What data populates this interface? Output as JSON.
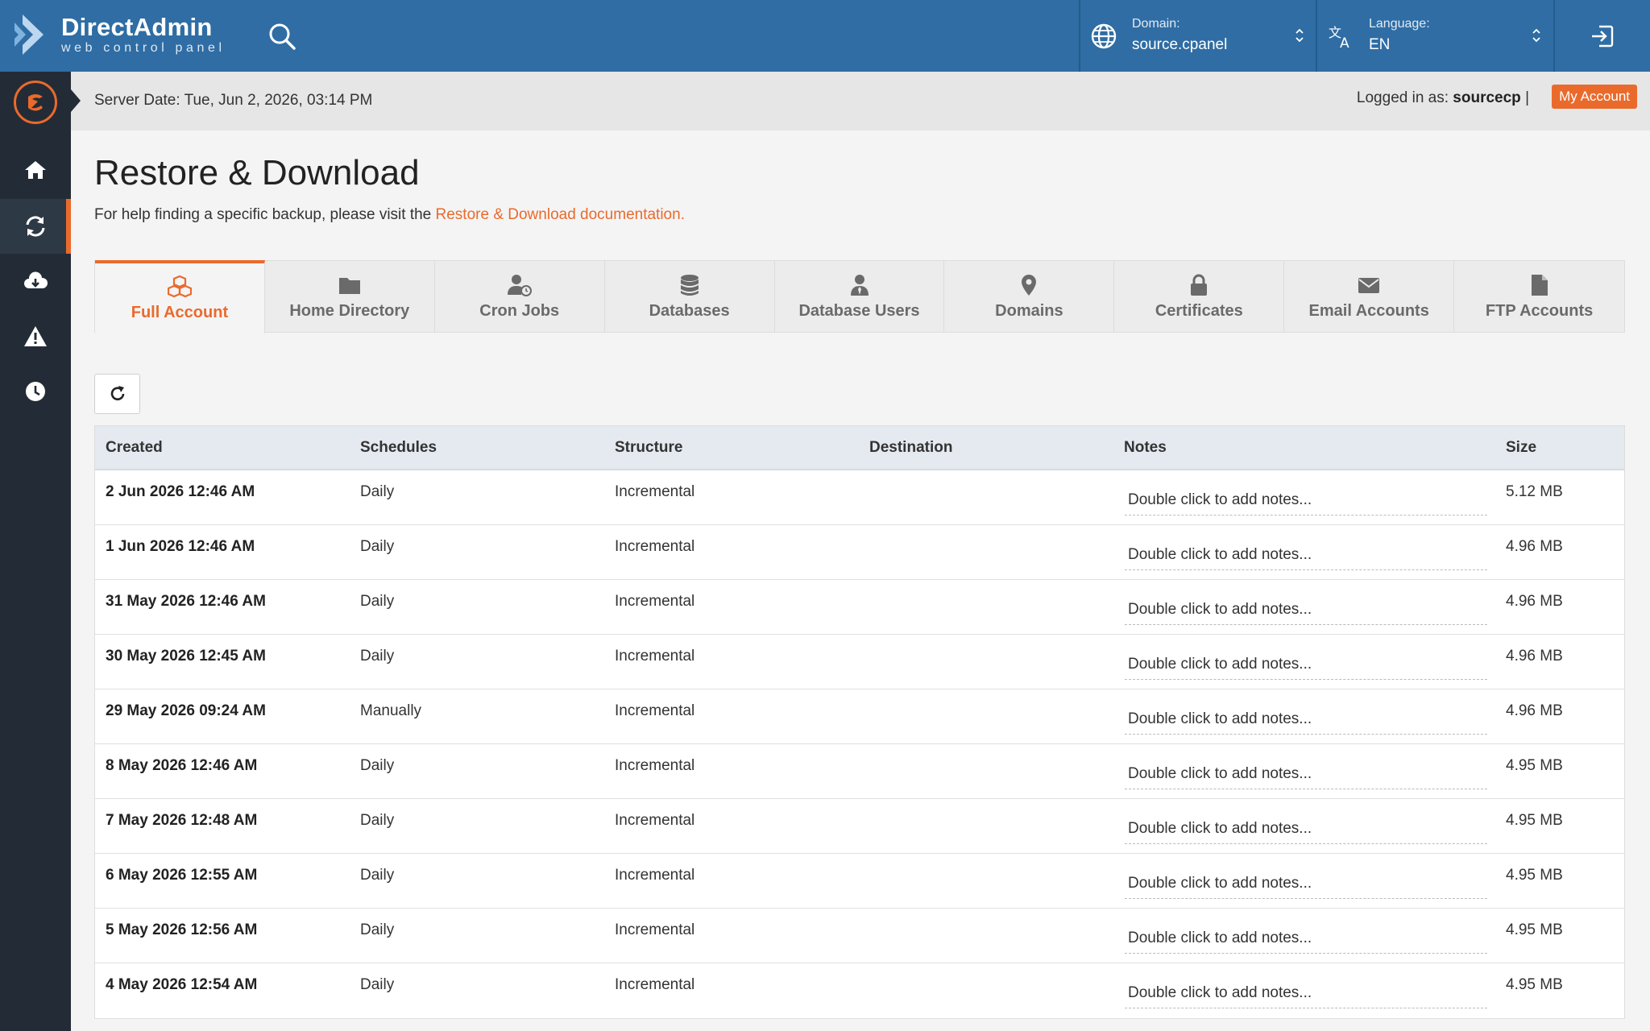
{
  "header": {
    "logo_title": "DirectAdmin",
    "logo_subtitle": "web control panel",
    "domain_label": "Domain:",
    "domain_value": "source.cpanel",
    "language_label": "Language:",
    "language_value": "EN"
  },
  "infobar": {
    "server_date": "Server Date: Tue, Jun 2, 2026, 03:14 PM",
    "logged_prefix": "Logged in as:",
    "username": "sourcecp",
    "separator": "|",
    "my_account": "My Account"
  },
  "page": {
    "title": "Restore & Download",
    "help_text": "For help finding a specific backup, please visit the ",
    "help_link": "Restore & Download documentation."
  },
  "tabs": [
    {
      "label": "Full Account",
      "icon": "cubes-icon",
      "active": true
    },
    {
      "label": "Home Directory",
      "icon": "folder-icon"
    },
    {
      "label": "Cron Jobs",
      "icon": "user-clock-icon"
    },
    {
      "label": "Databases",
      "icon": "database-icon"
    },
    {
      "label": "Database Users",
      "icon": "user-tie-icon"
    },
    {
      "label": "Domains",
      "icon": "map-marker-icon"
    },
    {
      "label": "Certificates",
      "icon": "lock-icon"
    },
    {
      "label": "Email Accounts",
      "icon": "envelope-icon"
    },
    {
      "label": "FTP Accounts",
      "icon": "file-icon"
    }
  ],
  "table": {
    "columns": [
      "Created",
      "Schedules",
      "Structure",
      "Destination",
      "Notes",
      "Size"
    ],
    "notes_placeholder": "Double click to add notes...",
    "rows": [
      {
        "created": "2 Jun 2026 12:46 AM",
        "schedule": "Daily",
        "structure": "Incremental",
        "destination": "",
        "size": "5.12 MB"
      },
      {
        "created": "1 Jun 2026 12:46 AM",
        "schedule": "Daily",
        "structure": "Incremental",
        "destination": "",
        "size": "4.96 MB"
      },
      {
        "created": "31 May 2026 12:46 AM",
        "schedule": "Daily",
        "structure": "Incremental",
        "destination": "",
        "size": "4.96 MB"
      },
      {
        "created": "30 May 2026 12:45 AM",
        "schedule": "Daily",
        "structure": "Incremental",
        "destination": "",
        "size": "4.96 MB"
      },
      {
        "created": "29 May 2026 09:24 AM",
        "schedule": "Manually",
        "structure": "Incremental",
        "destination": "",
        "size": "4.96 MB"
      },
      {
        "created": "8 May 2026 12:46 AM",
        "schedule": "Daily",
        "structure": "Incremental",
        "destination": "",
        "size": "4.95 MB"
      },
      {
        "created": "7 May 2026 12:48 AM",
        "schedule": "Daily",
        "structure": "Incremental",
        "destination": "",
        "size": "4.95 MB"
      },
      {
        "created": "6 May 2026 12:55 AM",
        "schedule": "Daily",
        "structure": "Incremental",
        "destination": "",
        "size": "4.95 MB"
      },
      {
        "created": "5 May 2026 12:56 AM",
        "schedule": "Daily",
        "structure": "Incremental",
        "destination": "",
        "size": "4.95 MB"
      },
      {
        "created": "4 May 2026 12:54 AM",
        "schedule": "Daily",
        "structure": "Incremental",
        "destination": "",
        "size": "4.95 MB"
      }
    ]
  },
  "colors": {
    "topbar": "#2f6da4",
    "sidebar": "#232c36",
    "accent": "#ea6a2c"
  }
}
